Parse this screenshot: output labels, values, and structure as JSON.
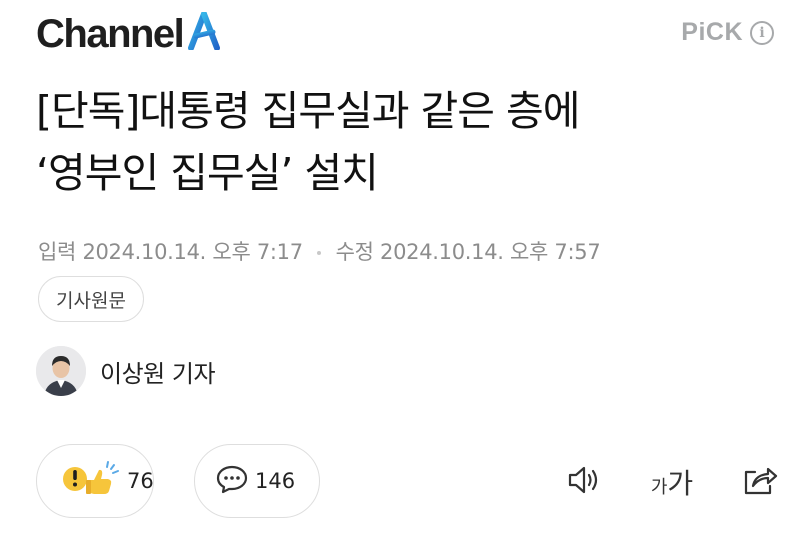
{
  "header": {
    "logo_text": "Channel",
    "logo_mark_icon": "channel-a-logo",
    "pick_label": "PiCK",
    "info_icon": "i",
    "colors": {
      "logo_accent": "#2f9dd9",
      "pick_gray": "#a7a9ab"
    }
  },
  "article": {
    "title_line1": "[단독]대통령 집무실과 같은 층에",
    "title_line2": "‘영부인 집무실’ 설치",
    "input_label": "입력",
    "input_date": "2024.10.14. 오후 7:17",
    "edit_label": "수정",
    "edit_date": "2024.10.14. 오후 7:57",
    "source_button": "기사원문"
  },
  "reporter": {
    "name": "이상원 기자"
  },
  "actions": {
    "reaction_count": "76",
    "comment_count": "146",
    "font_small": "가",
    "font_big": "가"
  }
}
